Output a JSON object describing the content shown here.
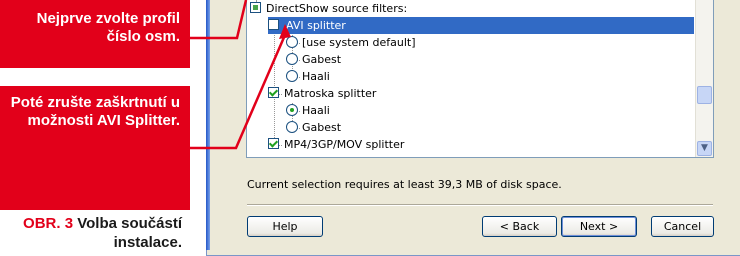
{
  "callouts": {
    "first": "Nejprve zvolte profil číslo osm.",
    "second": "Poté zrušte zaškrtnutí u možnosti AVI Splitter."
  },
  "caption": {
    "tag": "OBR. 3",
    "text": "Volba součástí instalace."
  },
  "tree": {
    "root": "DirectShow source filters:",
    "avi": "AVI splitter",
    "use_system_default": "[use system default]",
    "gabest_1": "Gabest",
    "haali_1": "Haali",
    "matroska": "Matroska splitter",
    "haali_2": "Haali",
    "gabest_2": "Gabest",
    "mp4": "MP4/3GP/MOV splitter"
  },
  "status": "Current selection requires at least 39,3 MB of disk space.",
  "buttons": {
    "help": "Help",
    "back": "< Back",
    "next": "Next >",
    "cancel": "Cancel"
  },
  "colors": {
    "accent_red": "#e2001a",
    "selection_blue": "#316ac5"
  }
}
